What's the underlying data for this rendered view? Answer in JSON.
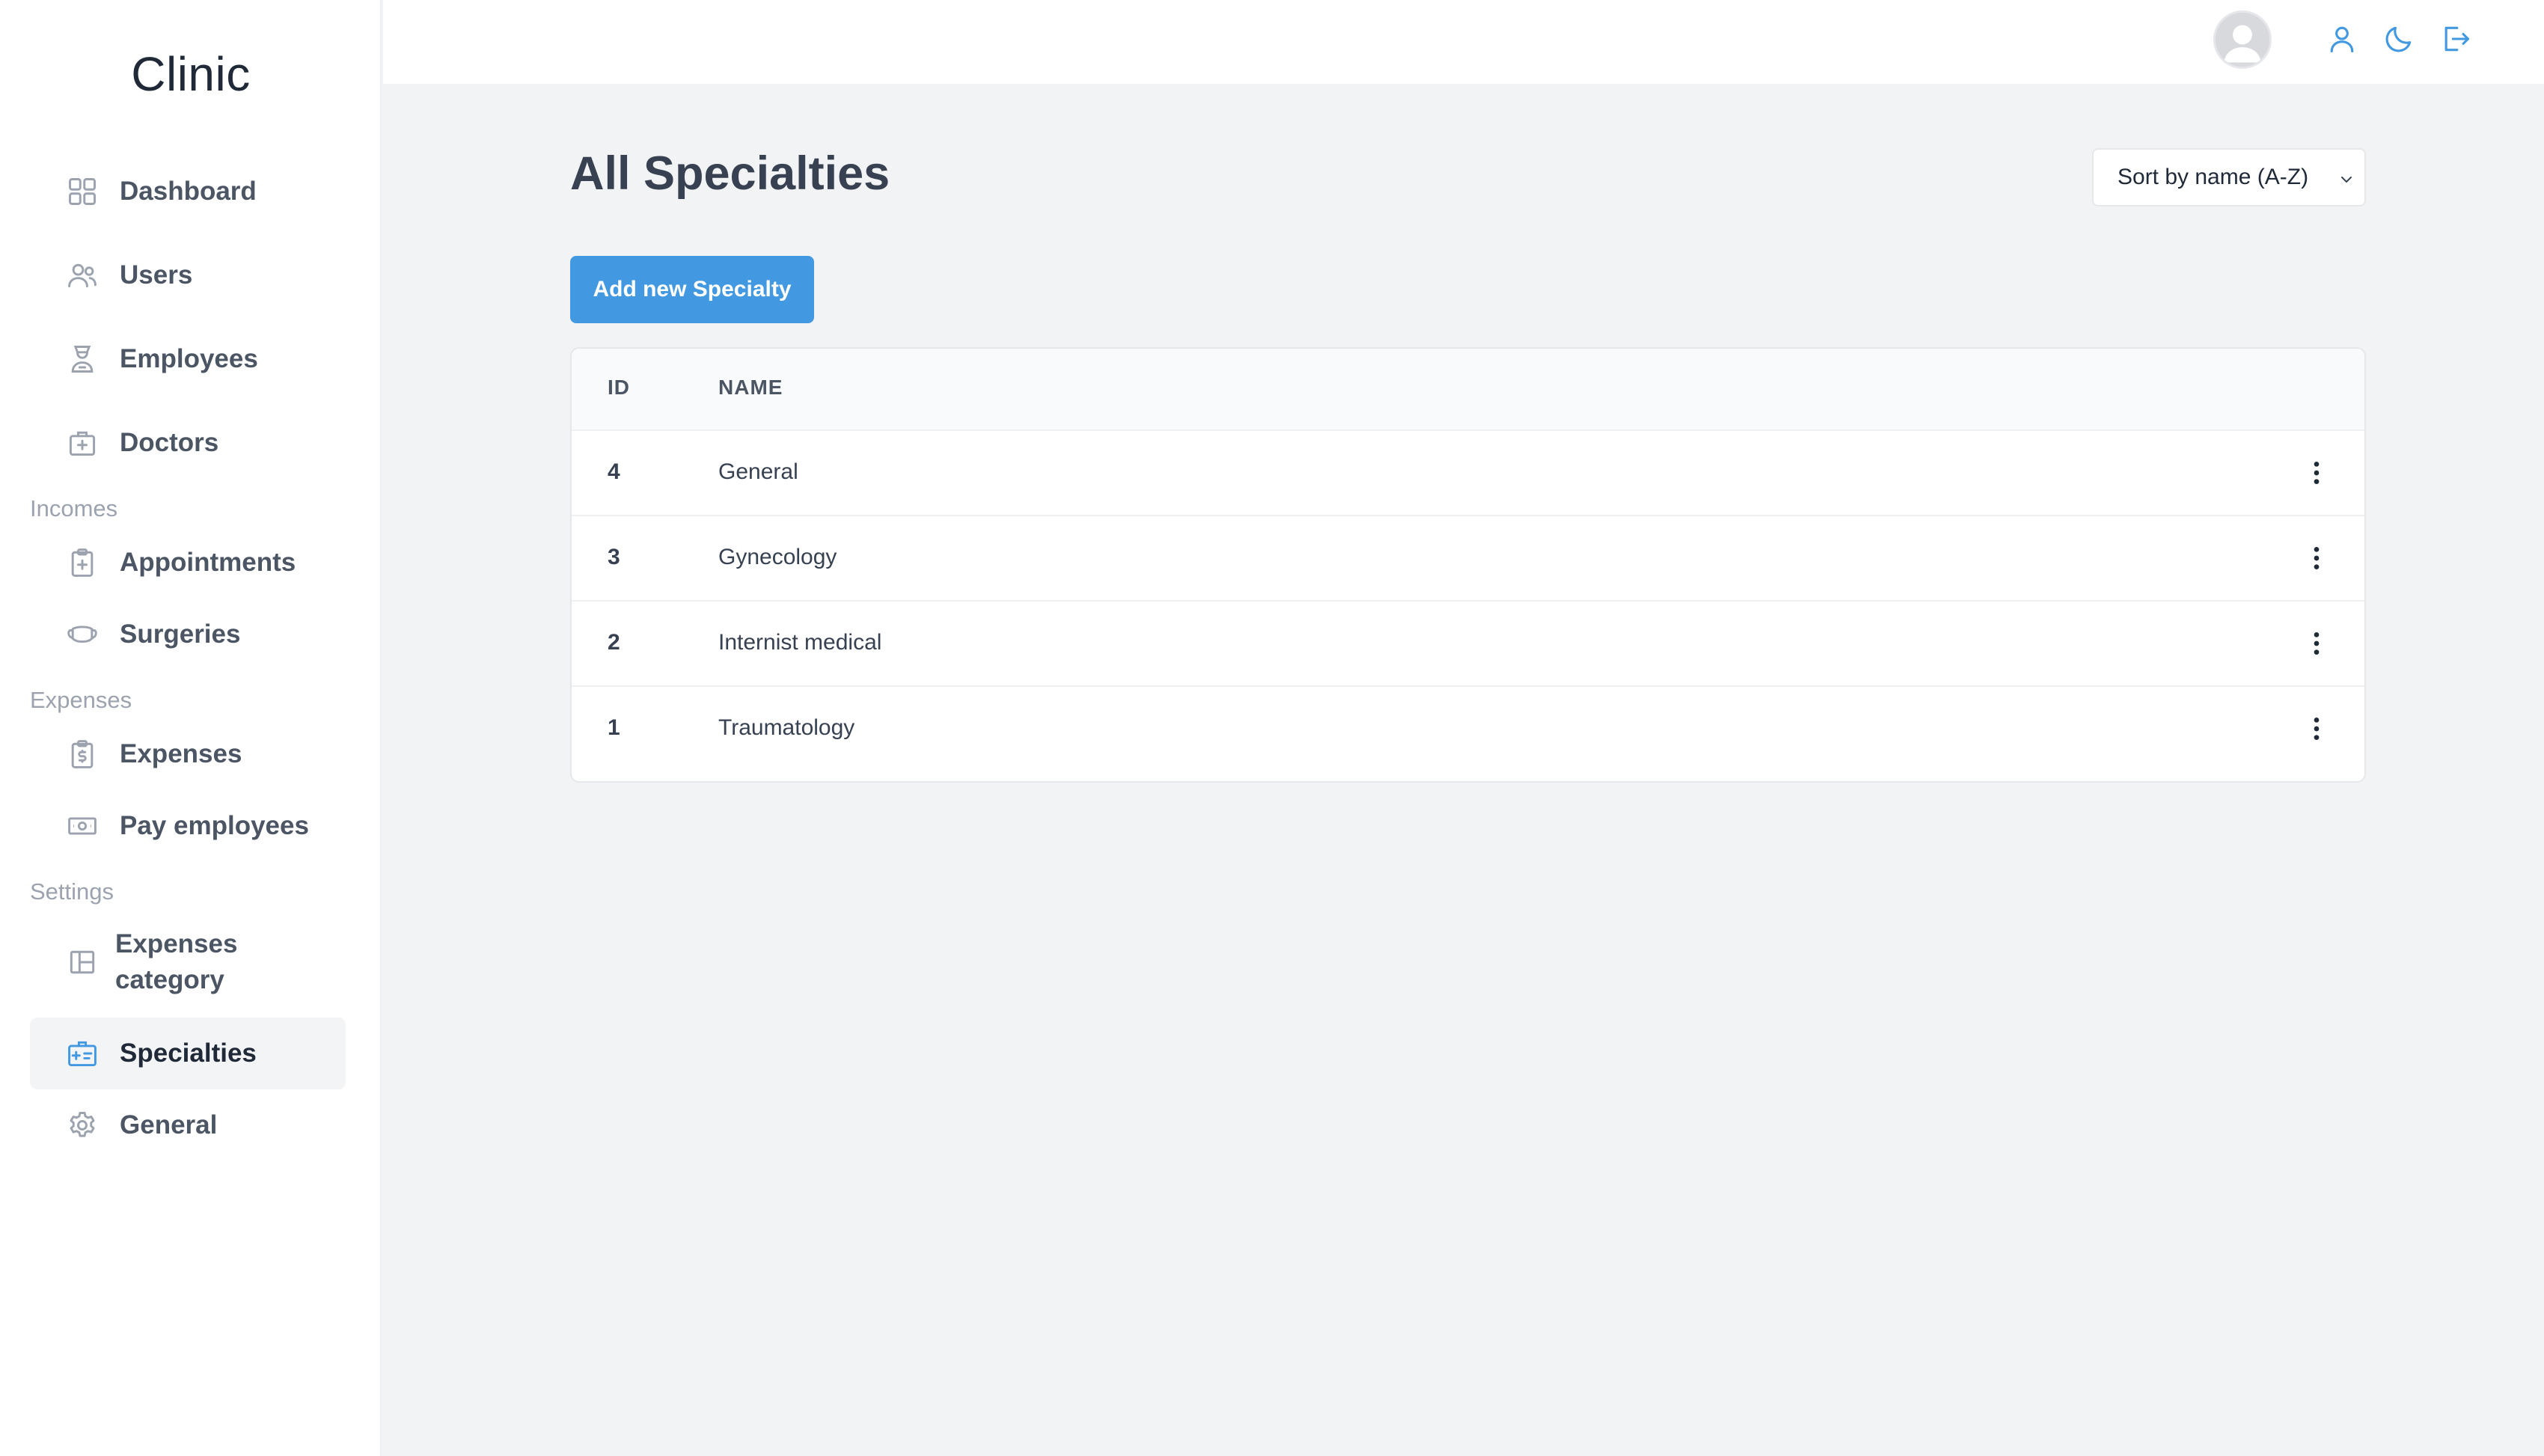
{
  "app": {
    "brand": "Clinic"
  },
  "sidebar": {
    "items": [
      {
        "label": "Dashboard",
        "icon": "dashboard-icon"
      },
      {
        "label": "Users",
        "icon": "users-icon"
      },
      {
        "label": "Employees",
        "icon": "employee-icon"
      },
      {
        "label": "Doctors",
        "icon": "doctor-bag-icon"
      },
      {
        "label": "Appointments",
        "icon": "clipboard-plus-icon"
      },
      {
        "label": "Surgeries",
        "icon": "mask-icon"
      },
      {
        "label": "Expenses",
        "icon": "clipboard-dollar-icon"
      },
      {
        "label": "Pay employees",
        "icon": "banknote-icon"
      },
      {
        "label": "Expenses category",
        "icon": "layout-icon"
      },
      {
        "label": "Specialties",
        "icon": "id-card-icon"
      },
      {
        "label": "General",
        "icon": "gear-icon"
      }
    ],
    "sections": {
      "incomes": "Incomes",
      "expenses": "Expenses",
      "settings": "Settings"
    },
    "active": "Specialties"
  },
  "topbar": {
    "icons": [
      "avatar",
      "user-icon",
      "moon-icon",
      "logout-icon"
    ]
  },
  "main": {
    "title": "All Specialties",
    "sort": {
      "selected": "Sort by name (A-Z)"
    },
    "add_button": "Add new Specialty",
    "table": {
      "columns": [
        "ID",
        "NAME"
      ],
      "rows": [
        {
          "id": "4",
          "name": "General"
        },
        {
          "id": "3",
          "name": "Gynecology"
        },
        {
          "id": "2",
          "name": "Internist medical"
        },
        {
          "id": "1",
          "name": "Traumatology"
        }
      ]
    }
  },
  "colors": {
    "accent": "#4299e1",
    "sidebar_bg": "#ffffff",
    "page_bg": "#f2f3f5",
    "text": "#374151"
  }
}
